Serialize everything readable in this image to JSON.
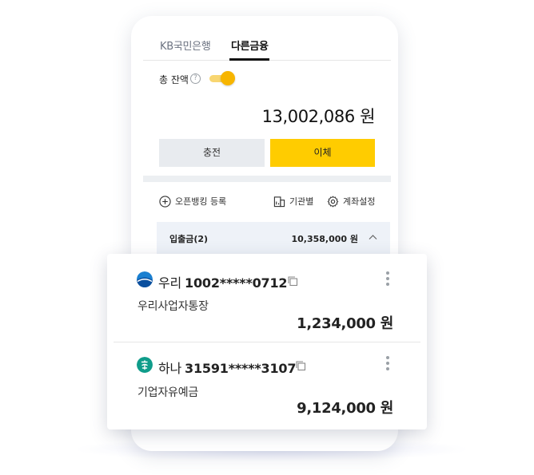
{
  "tabs": {
    "kb": "KB국민은행",
    "other": "다른금융"
  },
  "balance": {
    "label": "총 잔액",
    "help": "?",
    "toggle_on": true,
    "total": "13,002,086 원"
  },
  "buttons": {
    "charge": "충전",
    "transfer": "이체"
  },
  "actions": {
    "open_banking": "오픈뱅킹 등록",
    "by_institution": "기관별",
    "account_settings": "계좌설정"
  },
  "deposit": {
    "title": "입출금(2)",
    "amount": "10,358,000 원"
  },
  "accounts": [
    {
      "bank": "우리",
      "number": "1002*****0712",
      "name": "우리사업자통장",
      "balance": "1,234,000 원",
      "logo_color": "#1a7fd0"
    },
    {
      "bank": "하나",
      "number": "31591*****3107",
      "name": "기업자유예금",
      "balance": "9,124,000 원",
      "logo_color": "#0f9c8a"
    }
  ],
  "colors": {
    "accent": "#ffcc00",
    "toggle": "#f7b500"
  }
}
